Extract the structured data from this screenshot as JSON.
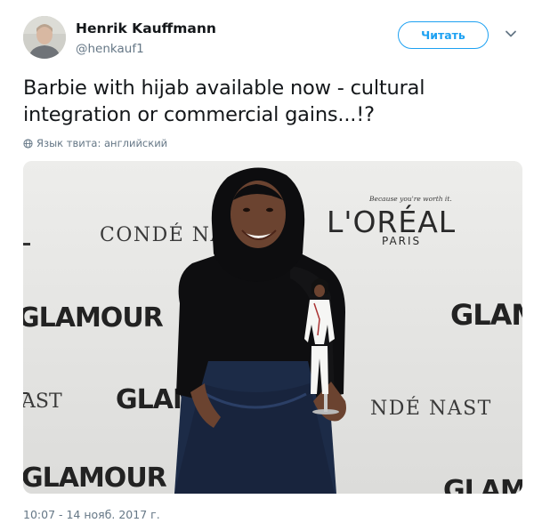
{
  "author": {
    "name": "Henrik Kauffmann",
    "handle": "@henkauf1",
    "avatar_icon": "user-avatar"
  },
  "follow_button": {
    "label": "Читать",
    "color": "#1da1f2"
  },
  "menu_icon": "chevron-down-icon",
  "tweet": {
    "text": "Barbie with hijab available now - cultural integration or commercial gains...!?",
    "language_label": "Язык твита: английский",
    "timestamp": "10:07 - 14 нояб. 2017 г."
  },
  "media": {
    "backdrop_logos": {
      "conde_nast": "CONDÉ NAST",
      "loreal_tagline": "Because you're worth it.",
      "loreal": "L'ORÉAL",
      "loreal_city": "PARIS",
      "glamour": "GLAMOUR",
      "glamour_partial": "GLAM",
      "ast_partial": "AST",
      "nde_nast_partial": "NDÉ NAST"
    }
  },
  "colors": {
    "text": "#14171a",
    "muted": "#657786",
    "accent": "#1da1f2"
  }
}
